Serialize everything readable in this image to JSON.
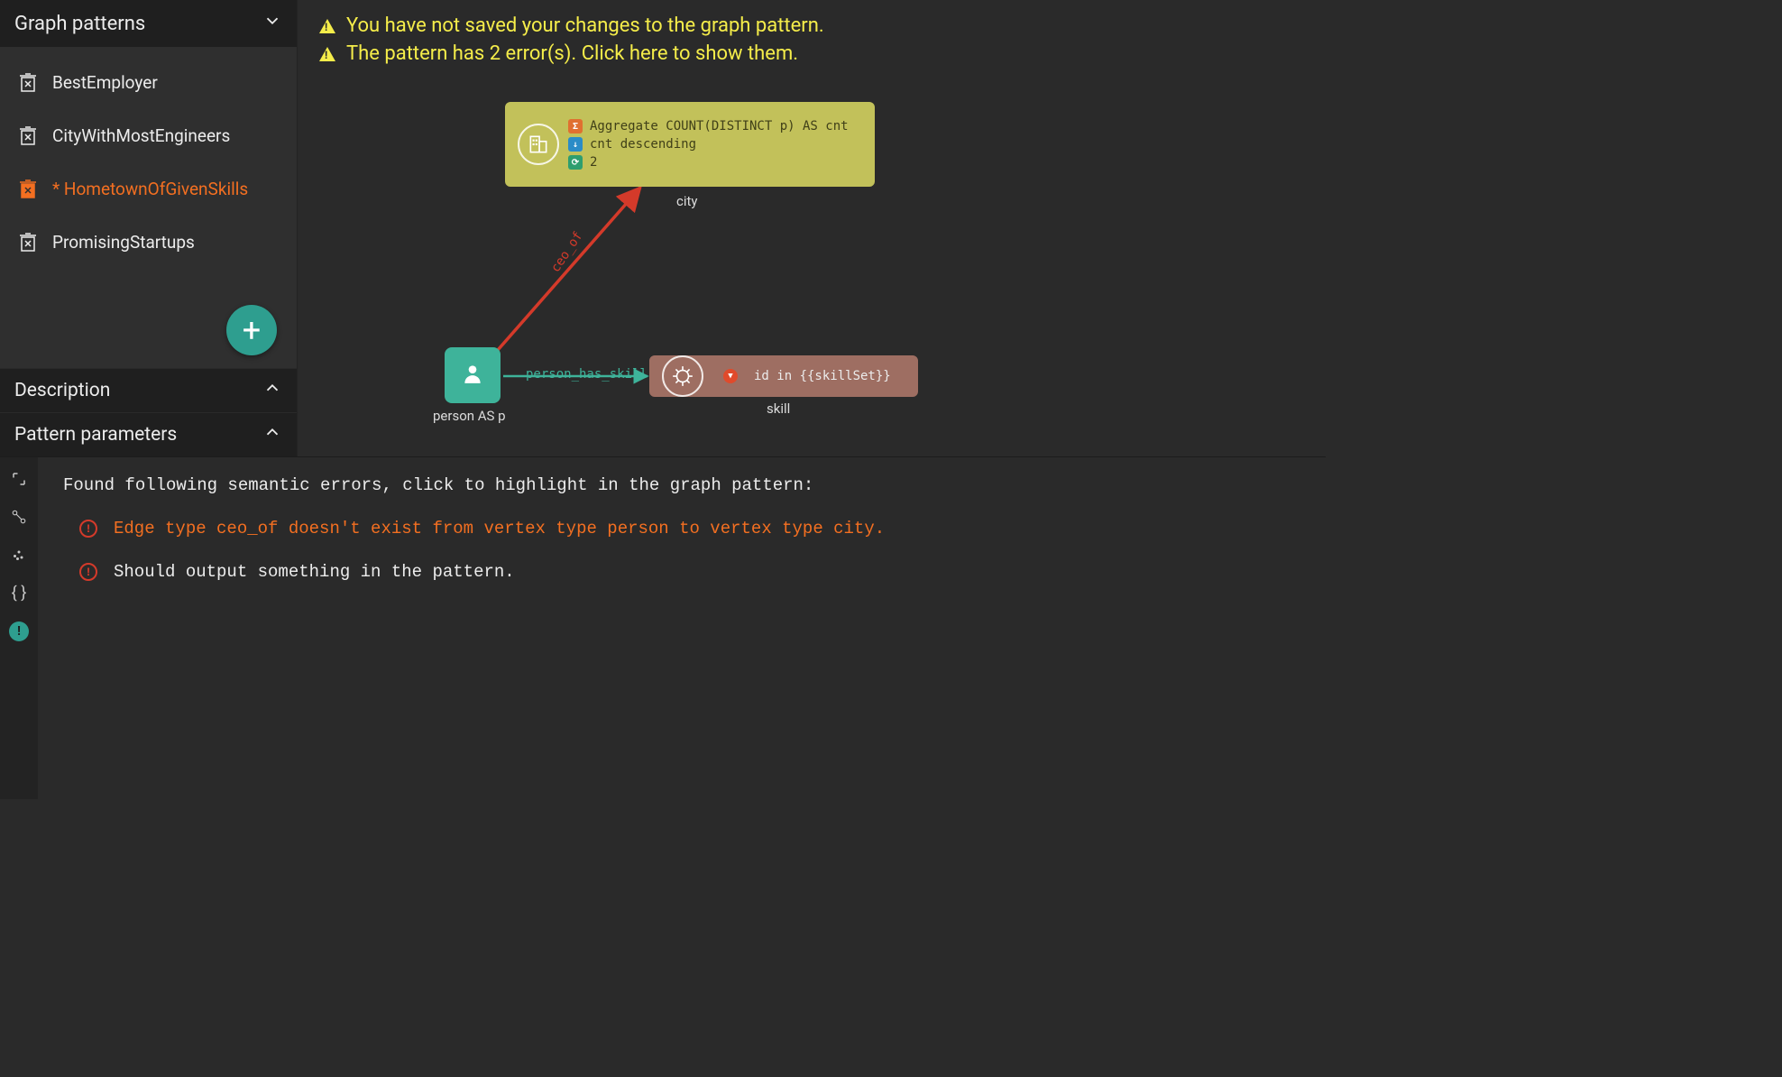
{
  "sidebar": {
    "header": "Graph patterns",
    "items": [
      {
        "label": "BestEmployer",
        "active": false
      },
      {
        "label": "CityWithMostEngineers",
        "active": false
      },
      {
        "label": "* HometownOfGivenSkills",
        "active": true
      },
      {
        "label": "PromisingStartups",
        "active": false
      }
    ],
    "add_label": "+",
    "description_section": "Description",
    "parameters_section": "Pattern parameters"
  },
  "banners": [
    "You have not saved your changes to the graph pattern.",
    "The pattern has 2 error(s). Click here to show them."
  ],
  "graph": {
    "city": {
      "label": "city",
      "lines": [
        {
          "tag": "Σ",
          "tagClass": "sigma",
          "text": "Aggregate COUNT(DISTINCT p) AS cnt"
        },
        {
          "tag": "↓",
          "tagClass": "sort",
          "text": "cnt descending"
        },
        {
          "tag": "⟳",
          "tagClass": "limit",
          "text": "2"
        }
      ]
    },
    "person": {
      "label": "person AS p"
    },
    "skill": {
      "label": "skill",
      "filter": "id in {{skillSet}}"
    },
    "edges": {
      "ceo_of": "ceo_of",
      "has_skill": "person_has_skill"
    }
  },
  "errors": {
    "title": "Found following semantic errors, click to highlight in the graph pattern:",
    "items": [
      {
        "msg": "Edge type ceo_of doesn't exist from vertex type person to vertex type city.",
        "highlight": true
      },
      {
        "msg": "Should output something in the pattern.",
        "highlight": false
      }
    ]
  },
  "rail": {
    "expand": "⛶",
    "pattern": "pattern",
    "data": "data",
    "braces": "{ }",
    "badge": "!"
  }
}
